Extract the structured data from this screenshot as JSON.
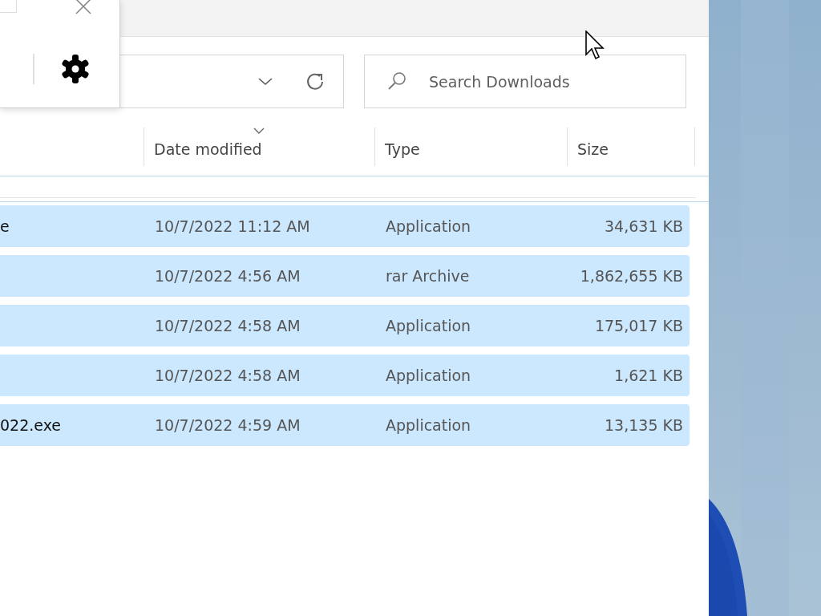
{
  "search": {
    "placeholder": "Search Downloads"
  },
  "columns": [
    {
      "label": "Date modified",
      "sorted": true
    },
    {
      "label": "Type",
      "sorted": false
    },
    {
      "label": "Size",
      "sorted": false
    }
  ],
  "rows": [
    {
      "name": "e",
      "date": "10/7/2022 11:12 AM",
      "type": "Application",
      "size": "34,631 KB",
      "selected": true
    },
    {
      "name": "",
      "date": "10/7/2022 4:56 AM",
      "type": "rar Archive",
      "size": "1,862,655 KB",
      "selected": true
    },
    {
      "name": "",
      "date": "10/7/2022 4:58 AM",
      "type": "Application",
      "size": "175,017 KB",
      "selected": true
    },
    {
      "name": "",
      "date": "10/7/2022 4:58 AM",
      "type": "Application",
      "size": "1,621 KB",
      "selected": true
    },
    {
      "name": "022.exe",
      "date": "10/7/2022 4:59 AM",
      "type": "Application",
      "size": "13,135 KB",
      "selected": true
    }
  ]
}
